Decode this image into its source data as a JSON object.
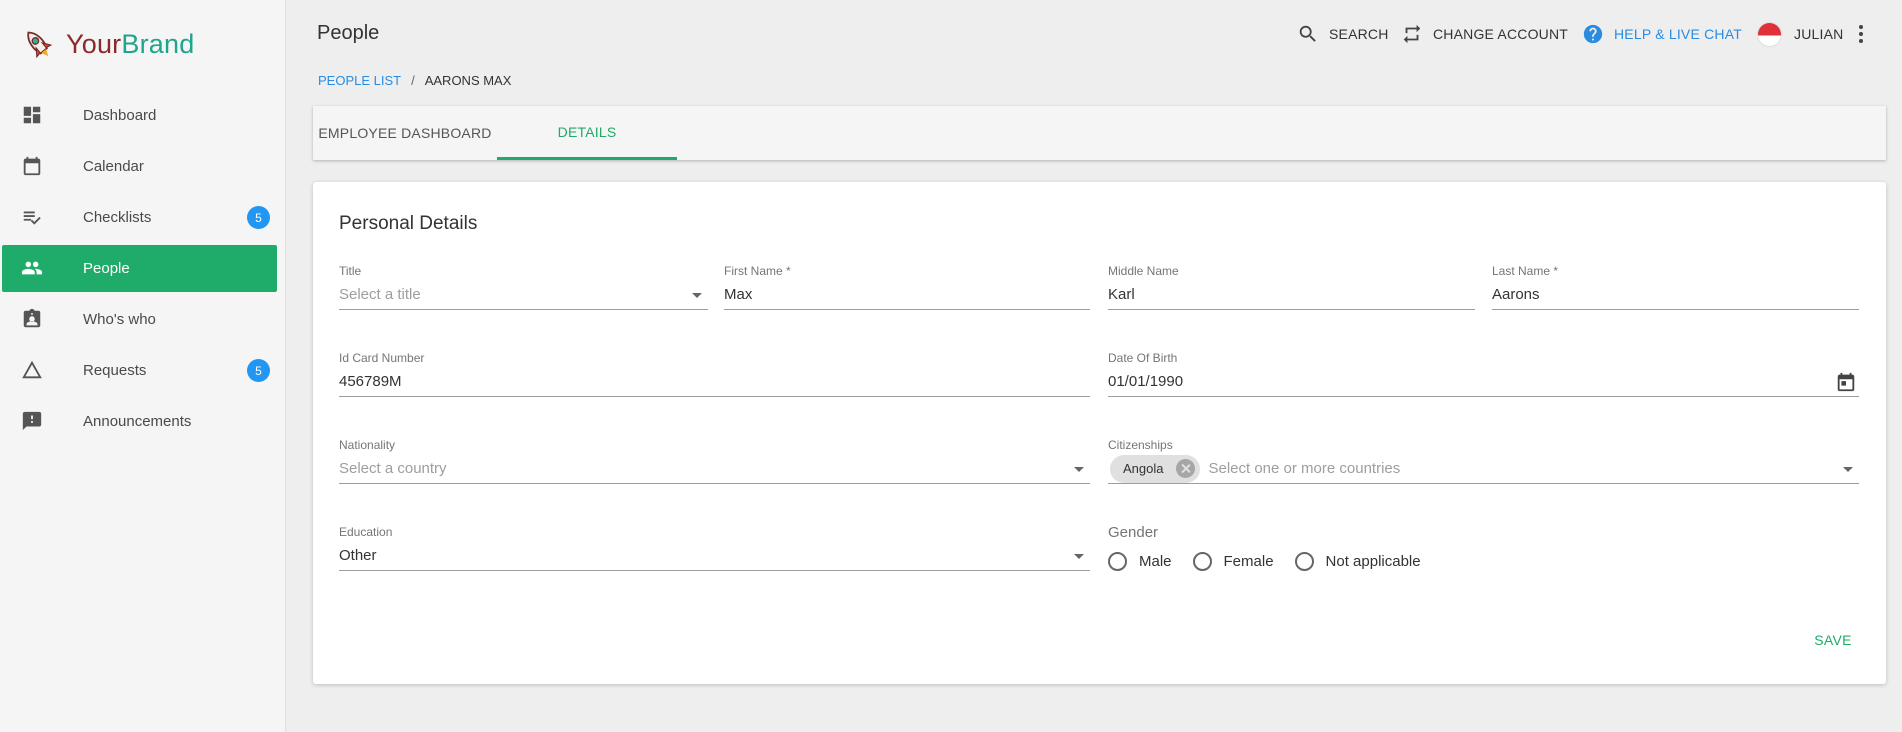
{
  "brand": {
    "part1": "Your",
    "part2": "Brand"
  },
  "sidebar": {
    "items": [
      {
        "label": "Dashboard",
        "icon": "dashboard-icon"
      },
      {
        "label": "Calendar",
        "icon": "calendar-icon"
      },
      {
        "label": "Checklists",
        "icon": "checklist-icon",
        "badge": "5"
      },
      {
        "label": "People",
        "icon": "people-icon",
        "active": true
      },
      {
        "label": "Who's who",
        "icon": "contact-card-icon"
      },
      {
        "label": "Requests",
        "icon": "triangle-icon",
        "badge": "5"
      },
      {
        "label": "Announcements",
        "icon": "announcement-icon"
      }
    ]
  },
  "header": {
    "title": "People",
    "search_label": "SEARCH",
    "change_account_label": "CHANGE ACCOUNT",
    "help_label": "HELP & LIVE CHAT",
    "user_name": "JULIAN"
  },
  "breadcrumb": {
    "link": "PEOPLE LIST",
    "separator": "/",
    "current": "AARONS MAX"
  },
  "tabs": [
    {
      "label": "EMPLOYEE DASHBOARD"
    },
    {
      "label": "DETAILS",
      "active": true
    }
  ],
  "form": {
    "title": "Personal Details",
    "title_field": {
      "label": "Title",
      "placeholder": "Select a title"
    },
    "first_name": {
      "label": "First Name *",
      "value": "Max"
    },
    "middle_name": {
      "label": "Middle Name",
      "value": "Karl"
    },
    "last_name": {
      "label": "Last Name *",
      "value": "Aarons"
    },
    "id_card": {
      "label": "Id Card Number",
      "value": "456789M"
    },
    "dob": {
      "label": "Date Of Birth",
      "value": "01/01/1990"
    },
    "nationality": {
      "label": "Nationality",
      "placeholder": "Select a country"
    },
    "citizenships": {
      "label": "Citizenships",
      "chip": "Angola",
      "placeholder": "Select one or more countries"
    },
    "education": {
      "label": "Education",
      "value": "Other"
    },
    "gender": {
      "label": "Gender",
      "options": [
        "Male",
        "Female",
        "Not applicable"
      ]
    },
    "save_label": "SAVE"
  },
  "colors": {
    "accent": "#1fab6a",
    "link": "#2a8ce0",
    "badge": "#2196f3"
  }
}
